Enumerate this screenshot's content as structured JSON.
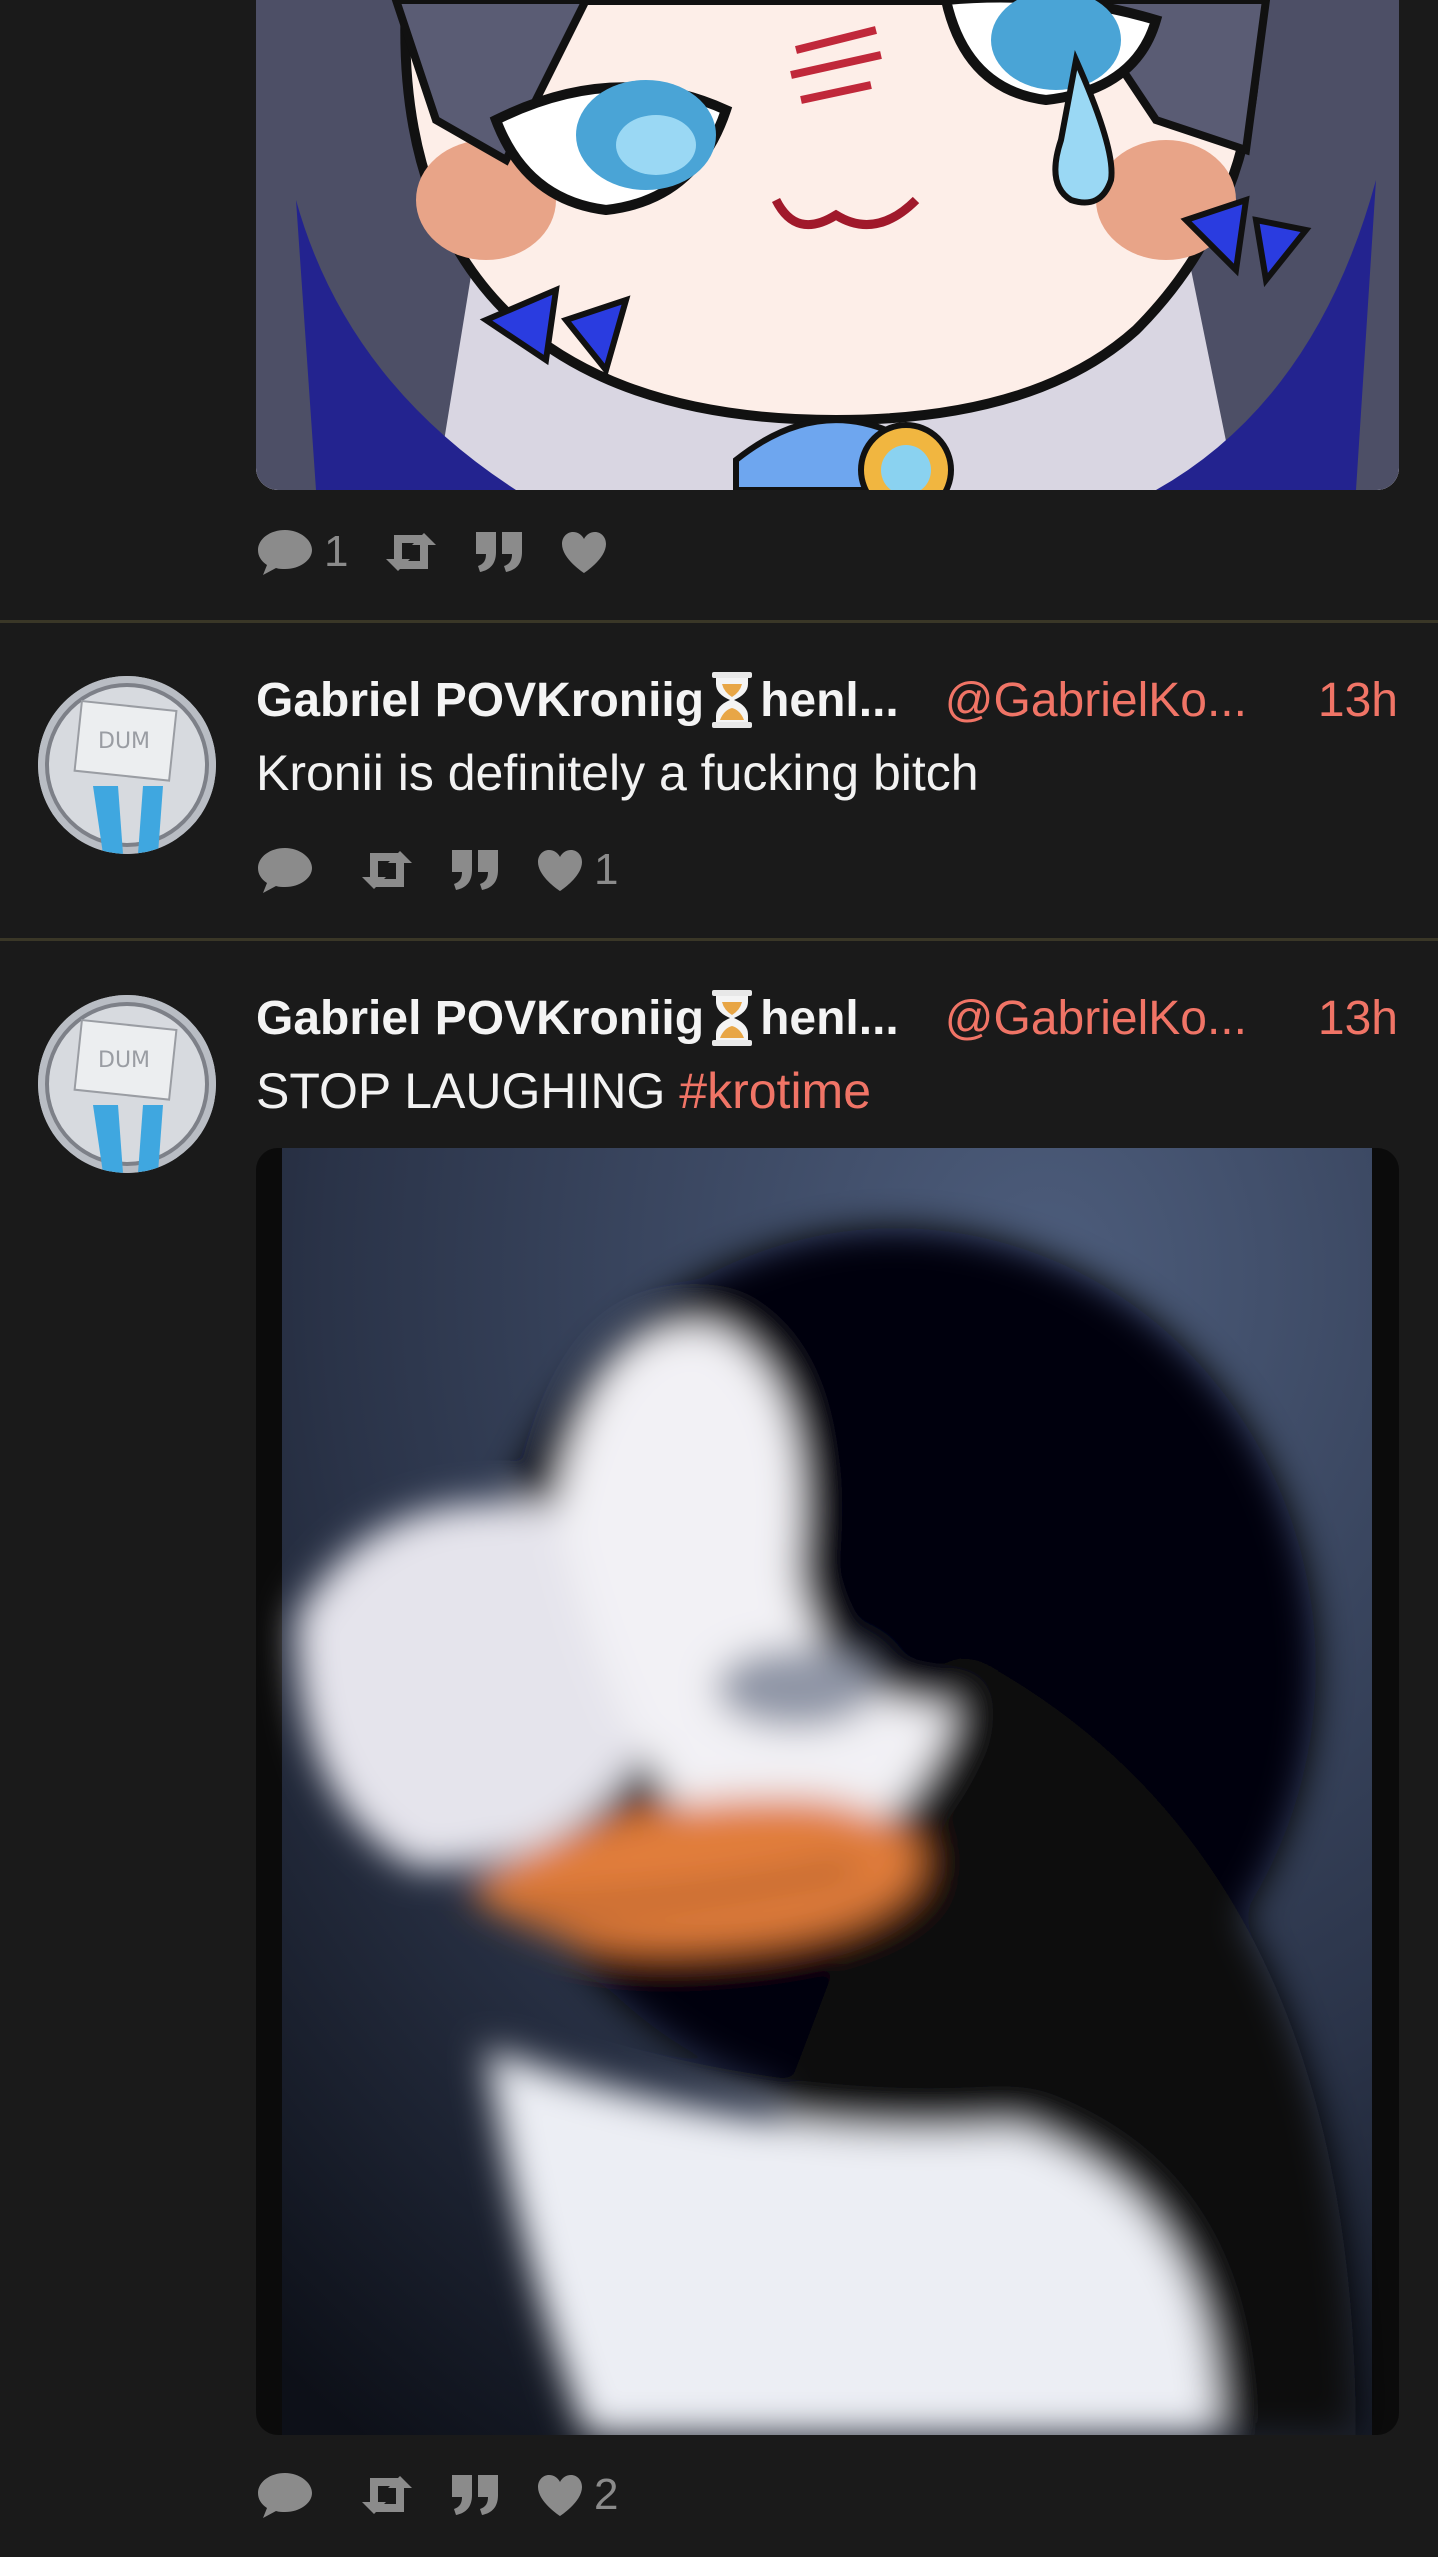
{
  "post1": {
    "media_alt_icon": "anime-character-image",
    "stats": {
      "replies": "1",
      "boosts": "",
      "likes": ""
    }
  },
  "post2": {
    "display_name": "Gabriel POVKroniig",
    "name_tail": "henl...",
    "handle": "@GabrielKo...",
    "time": "13h",
    "text": "Kronii is definitely a fucking bitch",
    "stats": {
      "replies": "",
      "boosts": "",
      "likes": "1"
    }
  },
  "post3": {
    "display_name": "Gabriel POVKroniig",
    "name_tail": "henl...",
    "handle": "@GabrielKo...",
    "time": "13h",
    "text": "STOP LAUGHING",
    "hashtag": "#krotime",
    "media_alt_icon": "penguin-image",
    "stats": {
      "replies": "",
      "boosts": "",
      "likes": "2"
    }
  },
  "colors": {
    "background": "#1a1a1a",
    "accent": "#f07466",
    "icon": "#8b8b8b",
    "divider": "#3a3727"
  }
}
